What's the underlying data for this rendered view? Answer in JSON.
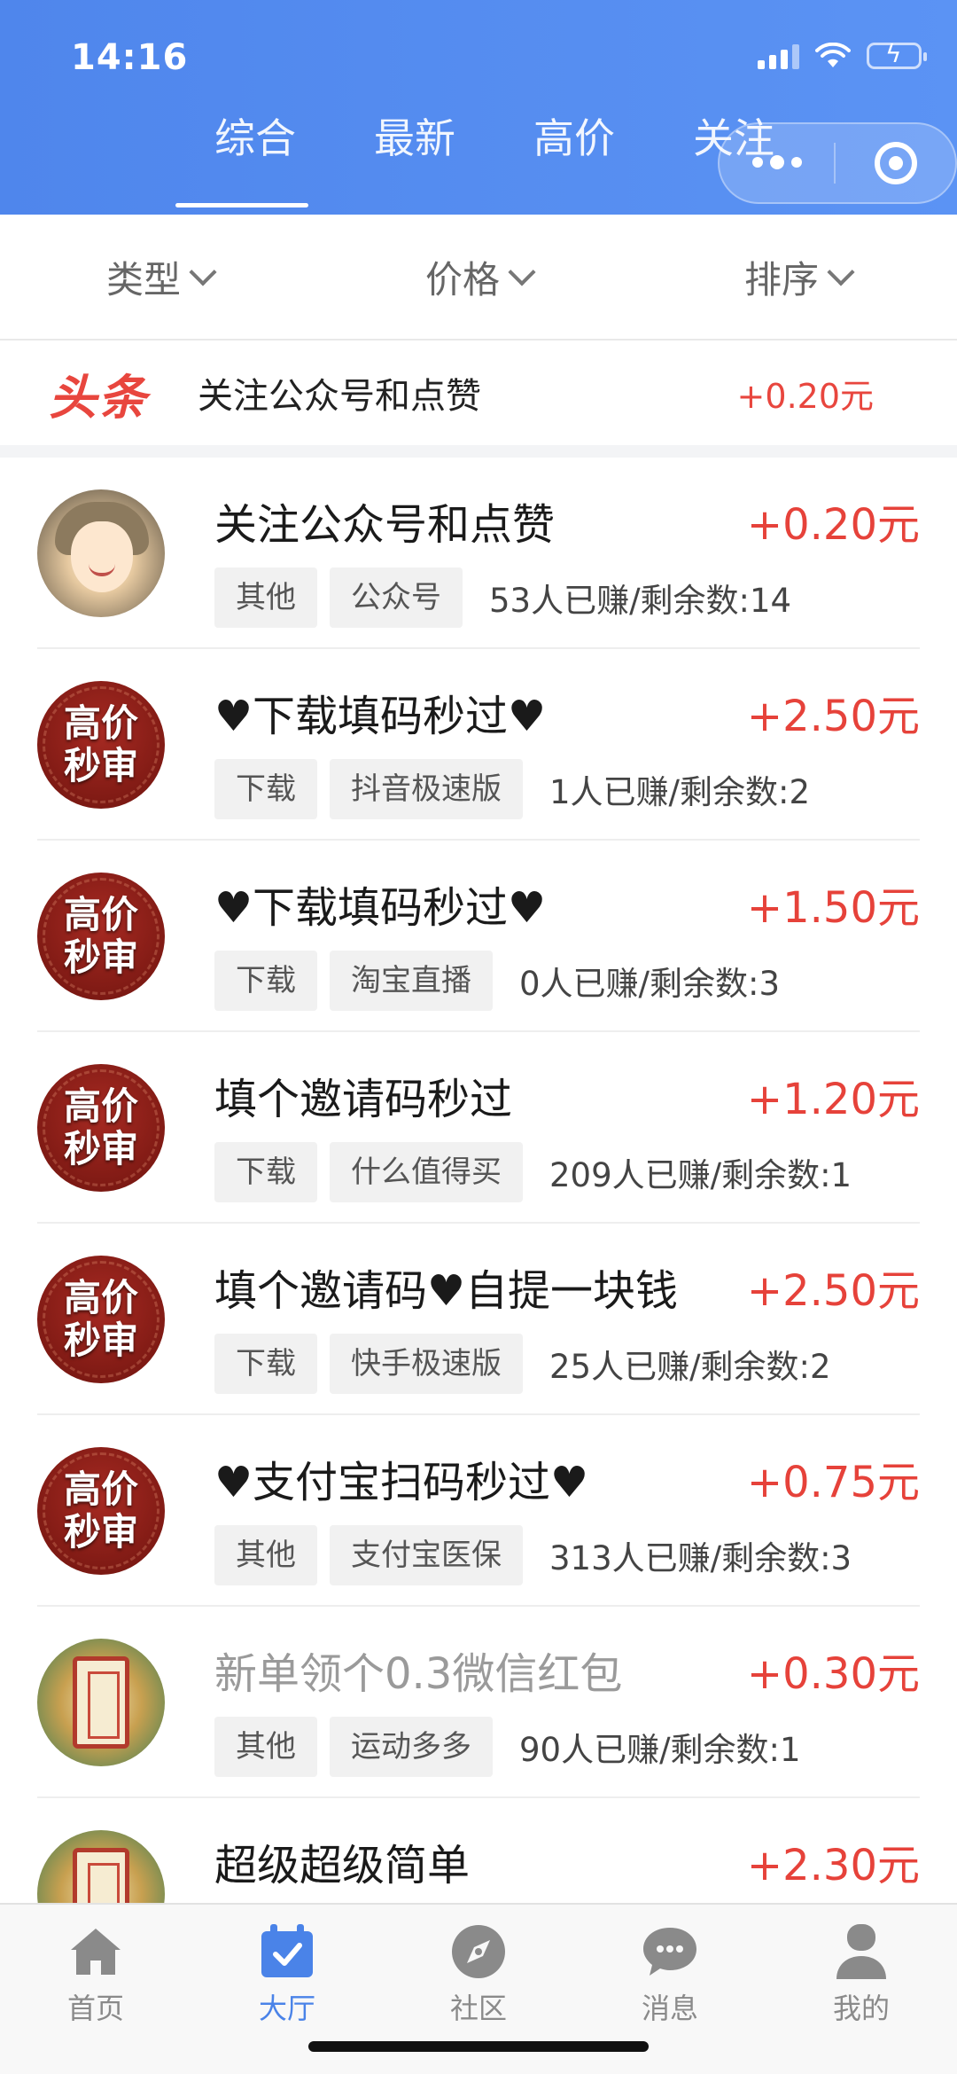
{
  "status_bar": {
    "time": "14:16"
  },
  "tabs": [
    {
      "label": "综合",
      "active": true
    },
    {
      "label": "最新",
      "active": false
    },
    {
      "label": "高价",
      "active": false
    },
    {
      "label": "关注",
      "active": false
    }
  ],
  "filters": [
    {
      "label": "类型"
    },
    {
      "label": "价格"
    },
    {
      "label": "排序"
    }
  ],
  "headline": {
    "tag": "头条",
    "title": "关注公众号和点赞",
    "price": "+0.20元"
  },
  "items": [
    {
      "avatar": "anime",
      "title": "关注公众号和点赞",
      "price": "+0.20元",
      "chips": [
        "其他",
        "公众号"
      ],
      "stats": "53人已赚/剩余数:14",
      "greyed": false
    },
    {
      "avatar": "hp",
      "avatar_text": [
        "高价",
        "秒审"
      ],
      "title": "♥下载填码秒过♥",
      "price": "+2.50元",
      "chips": [
        "下载",
        "抖音极速版"
      ],
      "stats": "1人已赚/剩余数:2",
      "greyed": false
    },
    {
      "avatar": "hp",
      "avatar_text": [
        "高价",
        "秒审"
      ],
      "title": "♥下载填码秒过♥",
      "price": "+1.50元",
      "chips": [
        "下载",
        "淘宝直播"
      ],
      "stats": "0人已赚/剩余数:3",
      "greyed": false
    },
    {
      "avatar": "hp",
      "avatar_text": [
        "高价",
        "秒审"
      ],
      "title": "填个邀请码秒过",
      "price": "+1.20元",
      "chips": [
        "下载",
        "什么值得买"
      ],
      "stats": "209人已赚/剩余数:1",
      "greyed": false
    },
    {
      "avatar": "hp",
      "avatar_text": [
        "高价",
        "秒审"
      ],
      "title": "填个邀请码♥自提一块钱",
      "price": "+2.50元",
      "chips": [
        "下载",
        "快手极速版"
      ],
      "stats": "25人已赚/剩余数:2",
      "greyed": false
    },
    {
      "avatar": "hp",
      "avatar_text": [
        "高价",
        "秒审"
      ],
      "title": "♥支付宝扫码秒过♥",
      "price": "+0.75元",
      "chips": [
        "其他",
        "支付宝医保"
      ],
      "stats": "313人已赚/剩余数:3",
      "greyed": false
    },
    {
      "avatar": "gold",
      "title": "新单领个0.3微信红包",
      "price": "+0.30元",
      "chips": [
        "其他",
        "运动多多"
      ],
      "stats": "90人已赚/剩余数:1",
      "greyed": true
    },
    {
      "avatar": "gold",
      "title": "超级超级简单",
      "price": "+2.30元",
      "chips": [],
      "stats": "",
      "greyed": false
    }
  ],
  "tabbar": [
    {
      "label": "首页",
      "icon": "home-icon",
      "active": false
    },
    {
      "label": "大厅",
      "icon": "calendar-check-icon",
      "active": true
    },
    {
      "label": "社区",
      "icon": "compass-icon",
      "active": false
    },
    {
      "label": "消息",
      "icon": "chat-bubble-icon",
      "active": false
    },
    {
      "label": "我的",
      "icon": "user-icon",
      "active": false
    }
  ],
  "colors": {
    "header": "#5b93f4",
    "price": "#e6423a",
    "active_tab": "#4a83e8",
    "badge_bg": "#8a1c16"
  }
}
